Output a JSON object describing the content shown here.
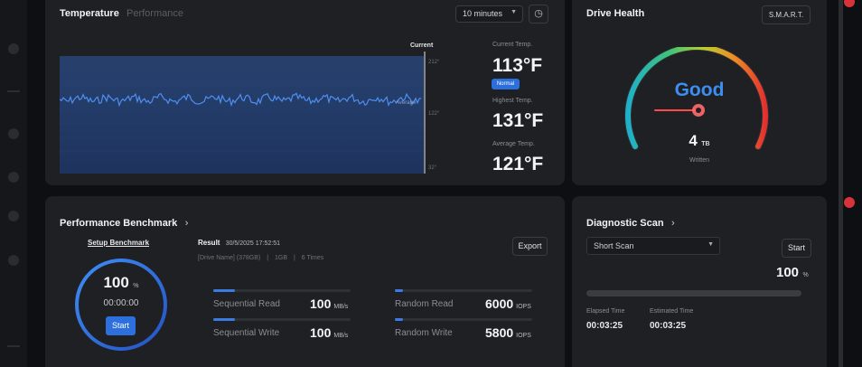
{
  "temperature": {
    "title": "Temperature",
    "tab_performance": "Performance",
    "range_select": "10 minutes",
    "chart_current_label": "Current",
    "y_ticks": [
      "212°",
      "122°",
      "32°"
    ],
    "average_tag": "Average",
    "current_label": "Current Temp.",
    "current_value": "113°F",
    "status_badge": "Normal",
    "highest_label": "Highest Temp.",
    "highest_value": "131°F",
    "average_label": "Average Temp.",
    "average_value": "121°F",
    "accent": "#2a6fdc"
  },
  "drive_health": {
    "title": "Drive Health",
    "smart_button": "S.M.A.R.T.",
    "status": "Good",
    "written_value": "4",
    "written_unit": "TB",
    "written_label": "Written"
  },
  "benchmark": {
    "title": "Performance Benchmark",
    "setup_link": "Setup Benchmark",
    "percent": "100",
    "percent_unit": "%",
    "elapsed": "00:00:00",
    "start_button": "Start",
    "result_label": "Result",
    "result_timestamp": "30/5/2025 17:52:51",
    "drive_name": "[Drive Name] (378GB)",
    "test_size": "1GB",
    "test_count": "6 Times",
    "export_button": "Export",
    "rows": [
      {
        "label": "Sequential Read",
        "value": "100",
        "unit": "MB/s",
        "progress": 0.16
      },
      {
        "label": "Sequential Write",
        "value": "100",
        "unit": "MB/s",
        "progress": 0.16
      },
      {
        "label": "Random Read",
        "value": "6000",
        "unit": "IOPS",
        "progress": 0.06
      },
      {
        "label": "Random Write",
        "value": "5800",
        "unit": "IOPS",
        "progress": 0.06
      }
    ]
  },
  "diagnostic": {
    "title": "Diagnostic Scan",
    "scan_type": "Short Scan",
    "start_button": "Start",
    "percent": "100",
    "percent_unit": "%",
    "elapsed_label": "Elapsed Time",
    "elapsed_value": "00:03:25",
    "estimated_label": "Estimated Time",
    "estimated_value": "00:03:25"
  }
}
